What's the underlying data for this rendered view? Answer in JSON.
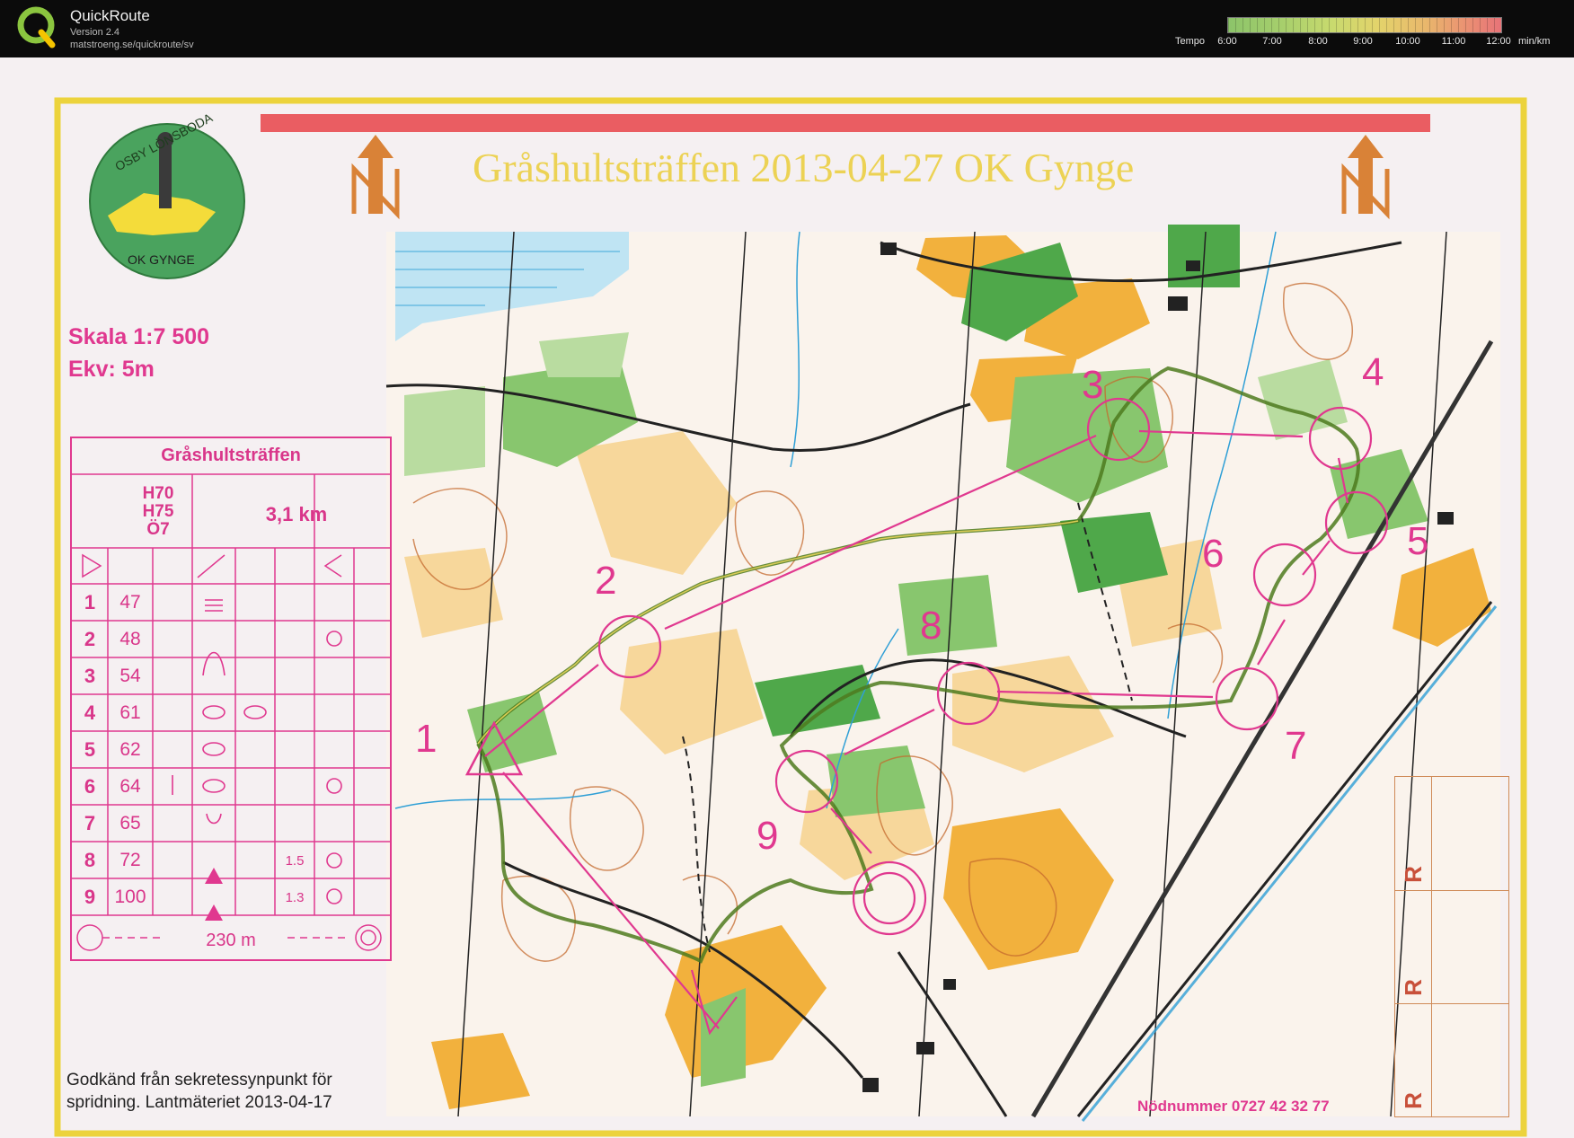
{
  "app": {
    "name": "QuickRoute",
    "version": "Version 2.4",
    "url": "matstroeng.se/quickroute/sv"
  },
  "tempo": {
    "title": "Tempo",
    "labels": [
      "6:00",
      "7:00",
      "8:00",
      "9:00",
      "10:00",
      "11:00",
      "12:00"
    ],
    "unit": "min/km",
    "colors": [
      "#8cc46a",
      "#c8da6e",
      "#e3d36b",
      "#e9b86c",
      "#ea8f73",
      "#e87378"
    ]
  },
  "map": {
    "title": "Gråshultsträffen 2013-04-27 OK Gynge",
    "scale": "Skala 1:7 500",
    "contour_interval": "Ekv: 5m",
    "club_logo": {
      "top_text": "OSBY LÖNSBODA",
      "name": "OK GYNGE"
    },
    "legal_line1": "Godkänd från sekretessynpunkt för",
    "legal_line2": "spridning. Lantmäteriet 2013-04-17",
    "emergency": "Nödnummer 0727 42 32 77",
    "reserved_labels": [
      "R",
      "R",
      "R"
    ],
    "course_color": "#e0388f",
    "route_color": "#4d7a1e"
  },
  "control_card": {
    "event": "Gråshultsträffen",
    "classes_line1": "H70",
    "classes_line2": "H75",
    "classes_line3": "Ö7",
    "length": "3,1 km",
    "controls": [
      {
        "num": "1",
        "code": "47",
        "dist": ""
      },
      {
        "num": "2",
        "code": "48",
        "dist": ""
      },
      {
        "num": "3",
        "code": "54",
        "dist": ""
      },
      {
        "num": "4",
        "code": "61",
        "dist": ""
      },
      {
        "num": "5",
        "code": "62",
        "dist": ""
      },
      {
        "num": "6",
        "code": "64",
        "dist": ""
      },
      {
        "num": "7",
        "code": "65",
        "dist": ""
      },
      {
        "num": "8",
        "code": "72",
        "dist": "1.5"
      },
      {
        "num": "9",
        "code": "100",
        "dist": "1.3"
      }
    ],
    "finish": "230 m"
  },
  "course_numbers": [
    "1",
    "2",
    "3",
    "4",
    "5",
    "6",
    "7",
    "8",
    "9"
  ]
}
